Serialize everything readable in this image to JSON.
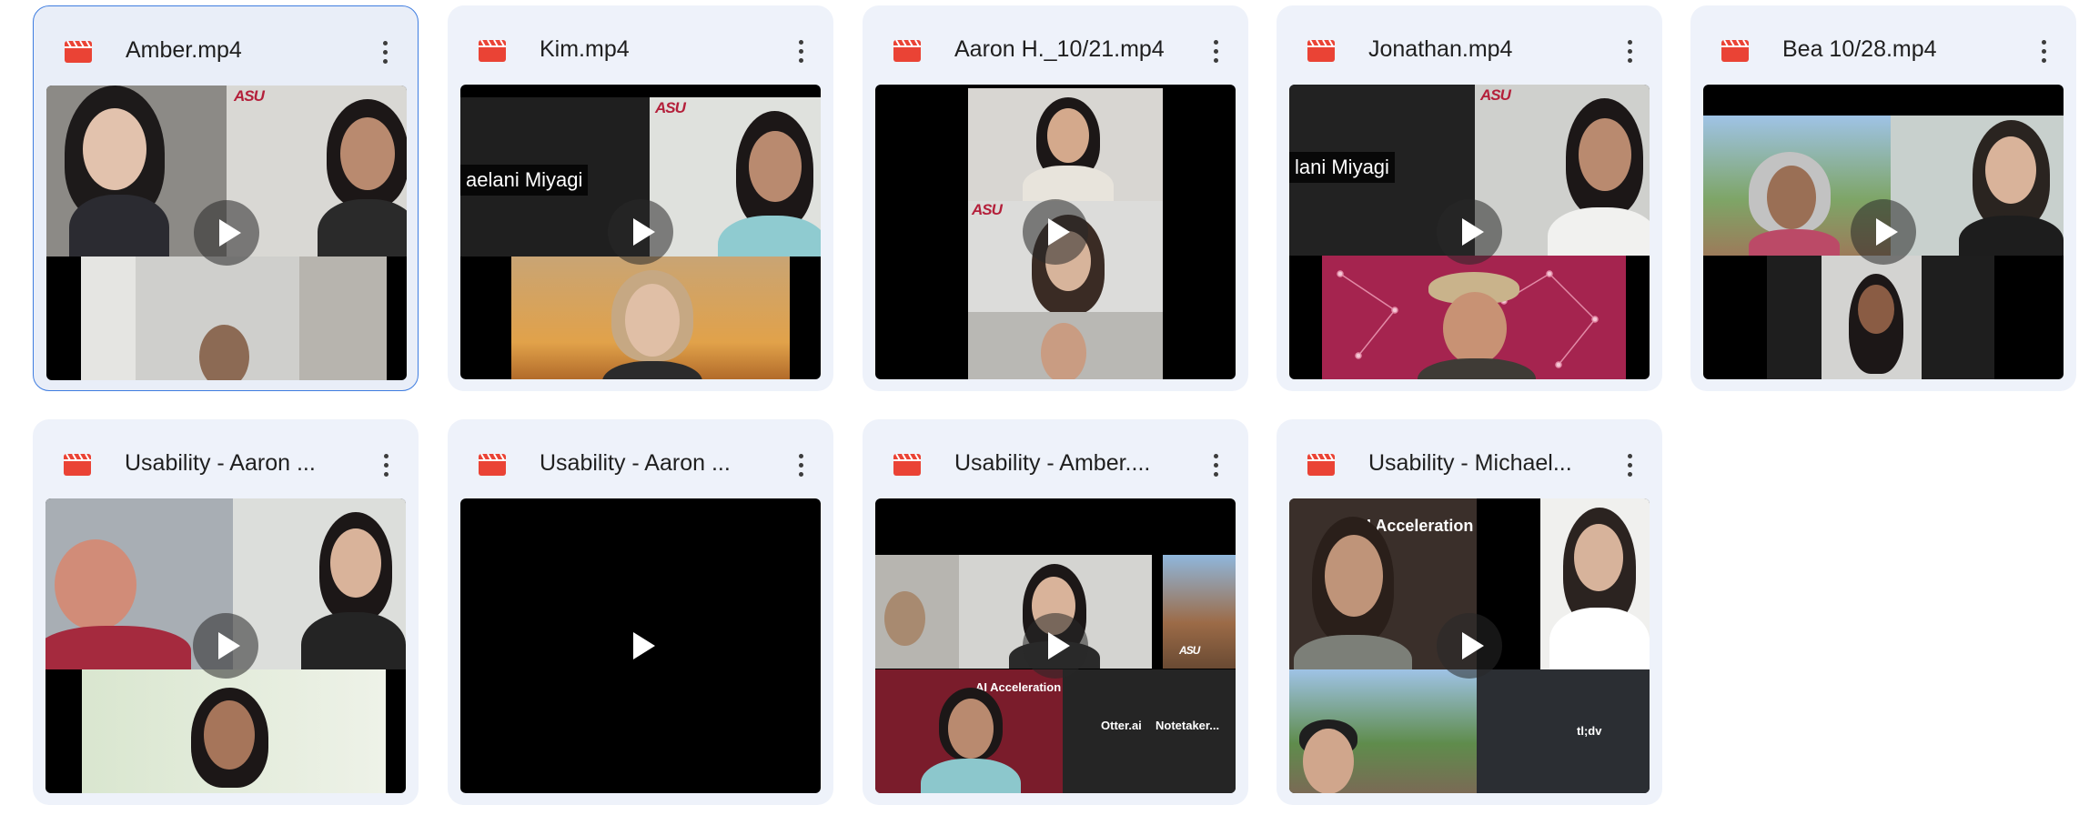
{
  "videos": [
    {
      "name": "Amber.mp4"
    },
    {
      "name": "Kim.mp4"
    },
    {
      "name": "Aaron H._10/21.mp4"
    },
    {
      "name": "Jonathan.mp4"
    },
    {
      "name": "Bea 10/28.mp4"
    },
    {
      "name": "Usability - Aaron ..."
    },
    {
      "name": "Usability - Aaron ..."
    },
    {
      "name": "Usability - Amber...."
    },
    {
      "name": "Usability - Michael..."
    }
  ],
  "overlays": {
    "kim_name_chip": "aelani Miyagi",
    "jonathan_name_chip": "lani Miyagi",
    "asu": "ASU",
    "ai_acceleration": "AI Acceleration",
    "otter": "Otter.ai",
    "notetaker": "Notetaker...",
    "tldv": "tl;dv"
  },
  "colors": {
    "card_bg": "#eef2fa",
    "selected_border": "#3f7de0",
    "video_icon": "#ea4335",
    "thumb_bg": "#000000"
  },
  "icons": {
    "file_type": "video-file-icon",
    "more": "more-vert-icon",
    "play": "play-icon"
  }
}
